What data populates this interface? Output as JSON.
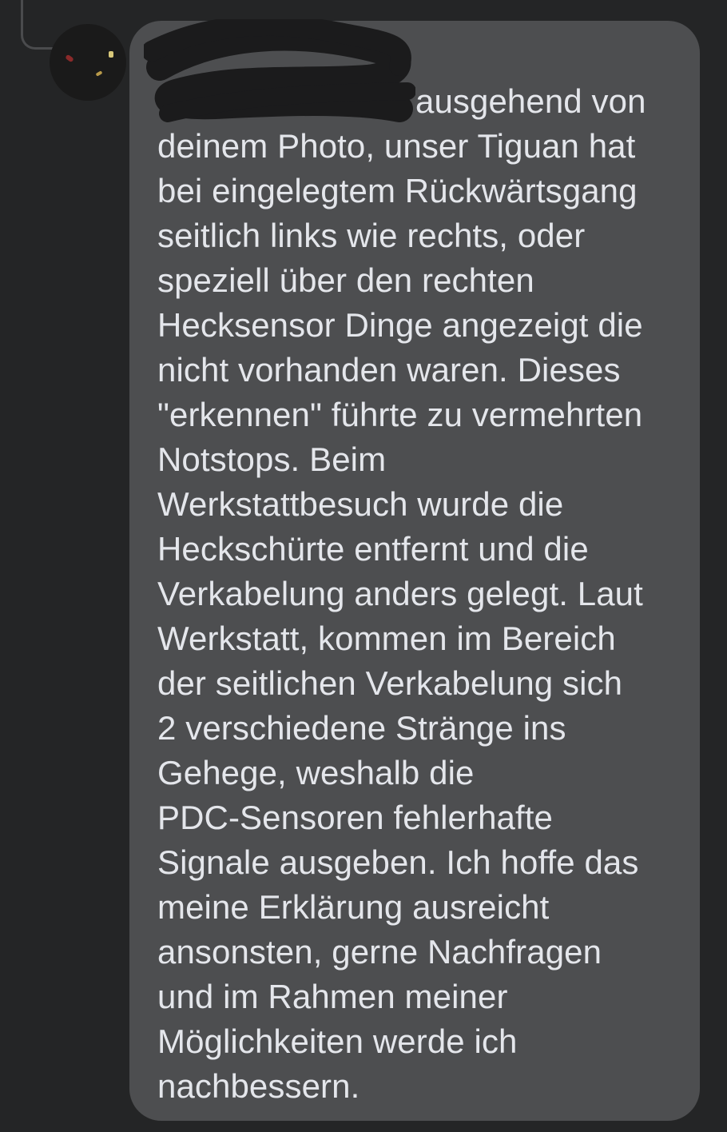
{
  "message": {
    "lines": [
      "ausgehend von",
      "deinem Photo, unser Tiguan hat",
      "bei eingelegtem Rückwärtsgang",
      "seitlich links wie rechts, oder",
      "speziell über den rechten",
      "Hecksensor Dinge angezeigt die",
      "nicht vorhanden waren. Dieses",
      "\"erkennen\" führte zu vermehrten",
      "Notstops. Beim",
      "Werkstattbesuch wurde die",
      "Heckschürte entfernt und die",
      "Verkabelung anders gelegt. Laut",
      "Werkstatt, kommen im Bereich",
      "der seitlichen Verkabelung sich",
      "2 verschiedene Stränge ins",
      "Gehege, weshalb die",
      "PDC-Sensoren fehlerhafte",
      "Signale ausgeben. Ich hoffe das",
      "meine Erklärung ausreicht",
      "ansonsten, gerne Nachfragen",
      "und im Rahmen meiner",
      "Möglichkeiten werde ich",
      "nachbessern."
    ]
  },
  "colors": {
    "background": "#242526",
    "bubble": "#4d4e50",
    "text": "#e4e6eb",
    "mention": "#2d88ff",
    "redaction": "#1b1b1c"
  }
}
